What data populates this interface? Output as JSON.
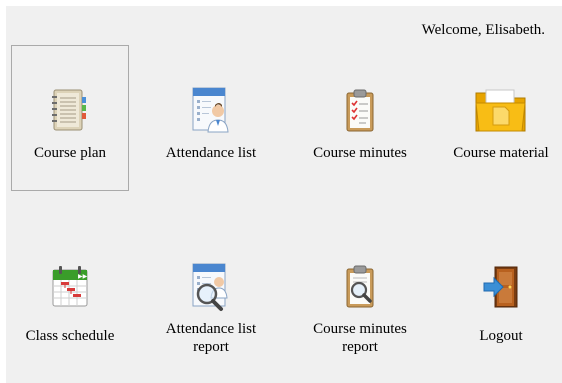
{
  "welcome": "Welcome, Elisabeth.",
  "tiles": [
    {
      "label": "Course plan",
      "icon": "notebook-icon"
    },
    {
      "label": "Attendance list",
      "icon": "attendance-list-icon"
    },
    {
      "label": "Course minutes",
      "icon": "clipboard-checklist-icon"
    },
    {
      "label": "Course material",
      "icon": "folder-icon"
    },
    {
      "label": "Class schedule",
      "icon": "calendar-gantt-icon"
    },
    {
      "label": "Attendance list report",
      "icon": "attendance-report-icon"
    },
    {
      "label": "Course minutes report",
      "icon": "clipboard-search-icon"
    },
    {
      "label": "Logout",
      "icon": "door-exit-icon"
    }
  ],
  "colors": {
    "background": "#f0f0f0",
    "selected_border": "#aaaaaa",
    "folder": "#f5b400",
    "calendar_header": "#3a9d2a",
    "exit_arrow": "#3b8fd6"
  }
}
